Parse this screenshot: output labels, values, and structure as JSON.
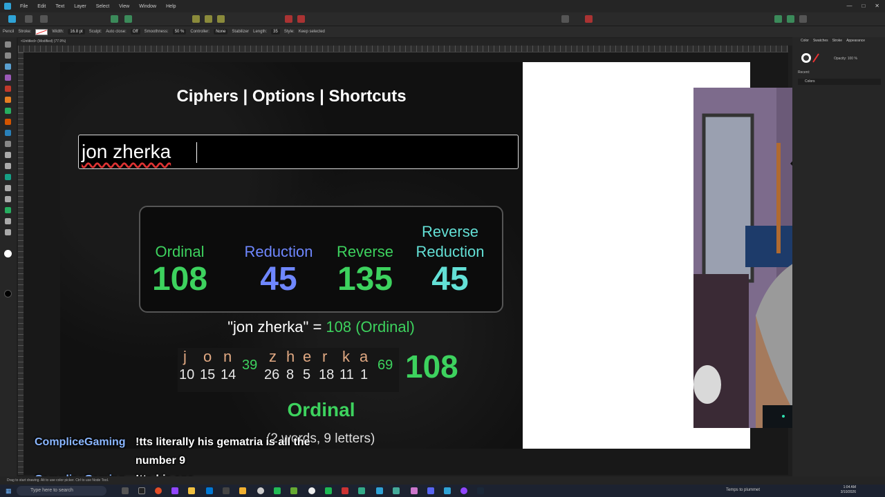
{
  "menubar": {
    "items": [
      "File",
      "Edit",
      "Text",
      "Layer",
      "Select",
      "View",
      "Window",
      "Help"
    ]
  },
  "context_toolbar": {
    "tool": "Pencil",
    "stroke_label": "Stroke:",
    "width_label": "Width:",
    "width_value": "16.8 pt",
    "sculpt_label": "Sculpt:",
    "autoclose_label": "Auto close:",
    "autoclose_value": "Off",
    "smoothness_label": "Smoothness:",
    "smoothness_value": "50 %",
    "controller_label": "Controller:",
    "controller_value": "None",
    "stabilizer_label": "Stabilizer",
    "length_label": "Length:",
    "length_value": "35",
    "style_label": "Style:",
    "keep_selected": "Keep selected"
  },
  "document_tab": "<Untitled> (Modified) (77.9%)",
  "gematria": {
    "nav": "Ciphers | Options | Shortcuts",
    "phrase": "jon zherka",
    "results": [
      {
        "label": "Ordinal",
        "value": "108",
        "color": "#3dd25e"
      },
      {
        "label": "Reduction",
        "value": "45",
        "color": "#6f87ff"
      },
      {
        "label": "Reverse",
        "value": "135",
        "color": "#3dd25e"
      },
      {
        "label1": "Reverse",
        "label2": "Reduction",
        "value": "45",
        "color": "#63e0d6"
      }
    ],
    "summary_quote": "\"jon zherka\" = ",
    "summary_value": "108 (Ordinal)",
    "word1_letters": [
      "j",
      "o",
      "n"
    ],
    "word1_values": [
      "10",
      "15",
      "14"
    ],
    "word1_sum": "39",
    "word2_letters": [
      "z",
      "h",
      "e",
      "r",
      "k",
      "a"
    ],
    "word2_values": [
      "26",
      "8",
      "5",
      "18",
      "11",
      "1"
    ],
    "word2_sum": "69",
    "total": "108",
    "cipher_name": "Ordinal",
    "word_count": "(2 words, 9 letters)"
  },
  "chat": [
    {
      "user": "CompliceGaming",
      "message_line1": "!tts literally his gematria is all the",
      "message_line2": "number 9"
    },
    {
      "user": "CompliceGaming",
      "message_line1": "!tts his ego"
    }
  ],
  "right_panel": {
    "tabs": [
      "Color",
      "Swatches",
      "Stroke",
      "Appearance"
    ],
    "opacity_label": "Opacity:",
    "opacity_value": "100 %",
    "recent_label": "Recent:",
    "palette_name": "Colors"
  },
  "statusbar": {
    "hint": "Drag to start drawing. Alt to use color picker. Ctrl to use Node Tool."
  },
  "taskbar": {
    "search_placeholder": "Type here to search",
    "weather": "Temps to plummet",
    "time": "1:04 AM",
    "date": "3/10/2026"
  }
}
